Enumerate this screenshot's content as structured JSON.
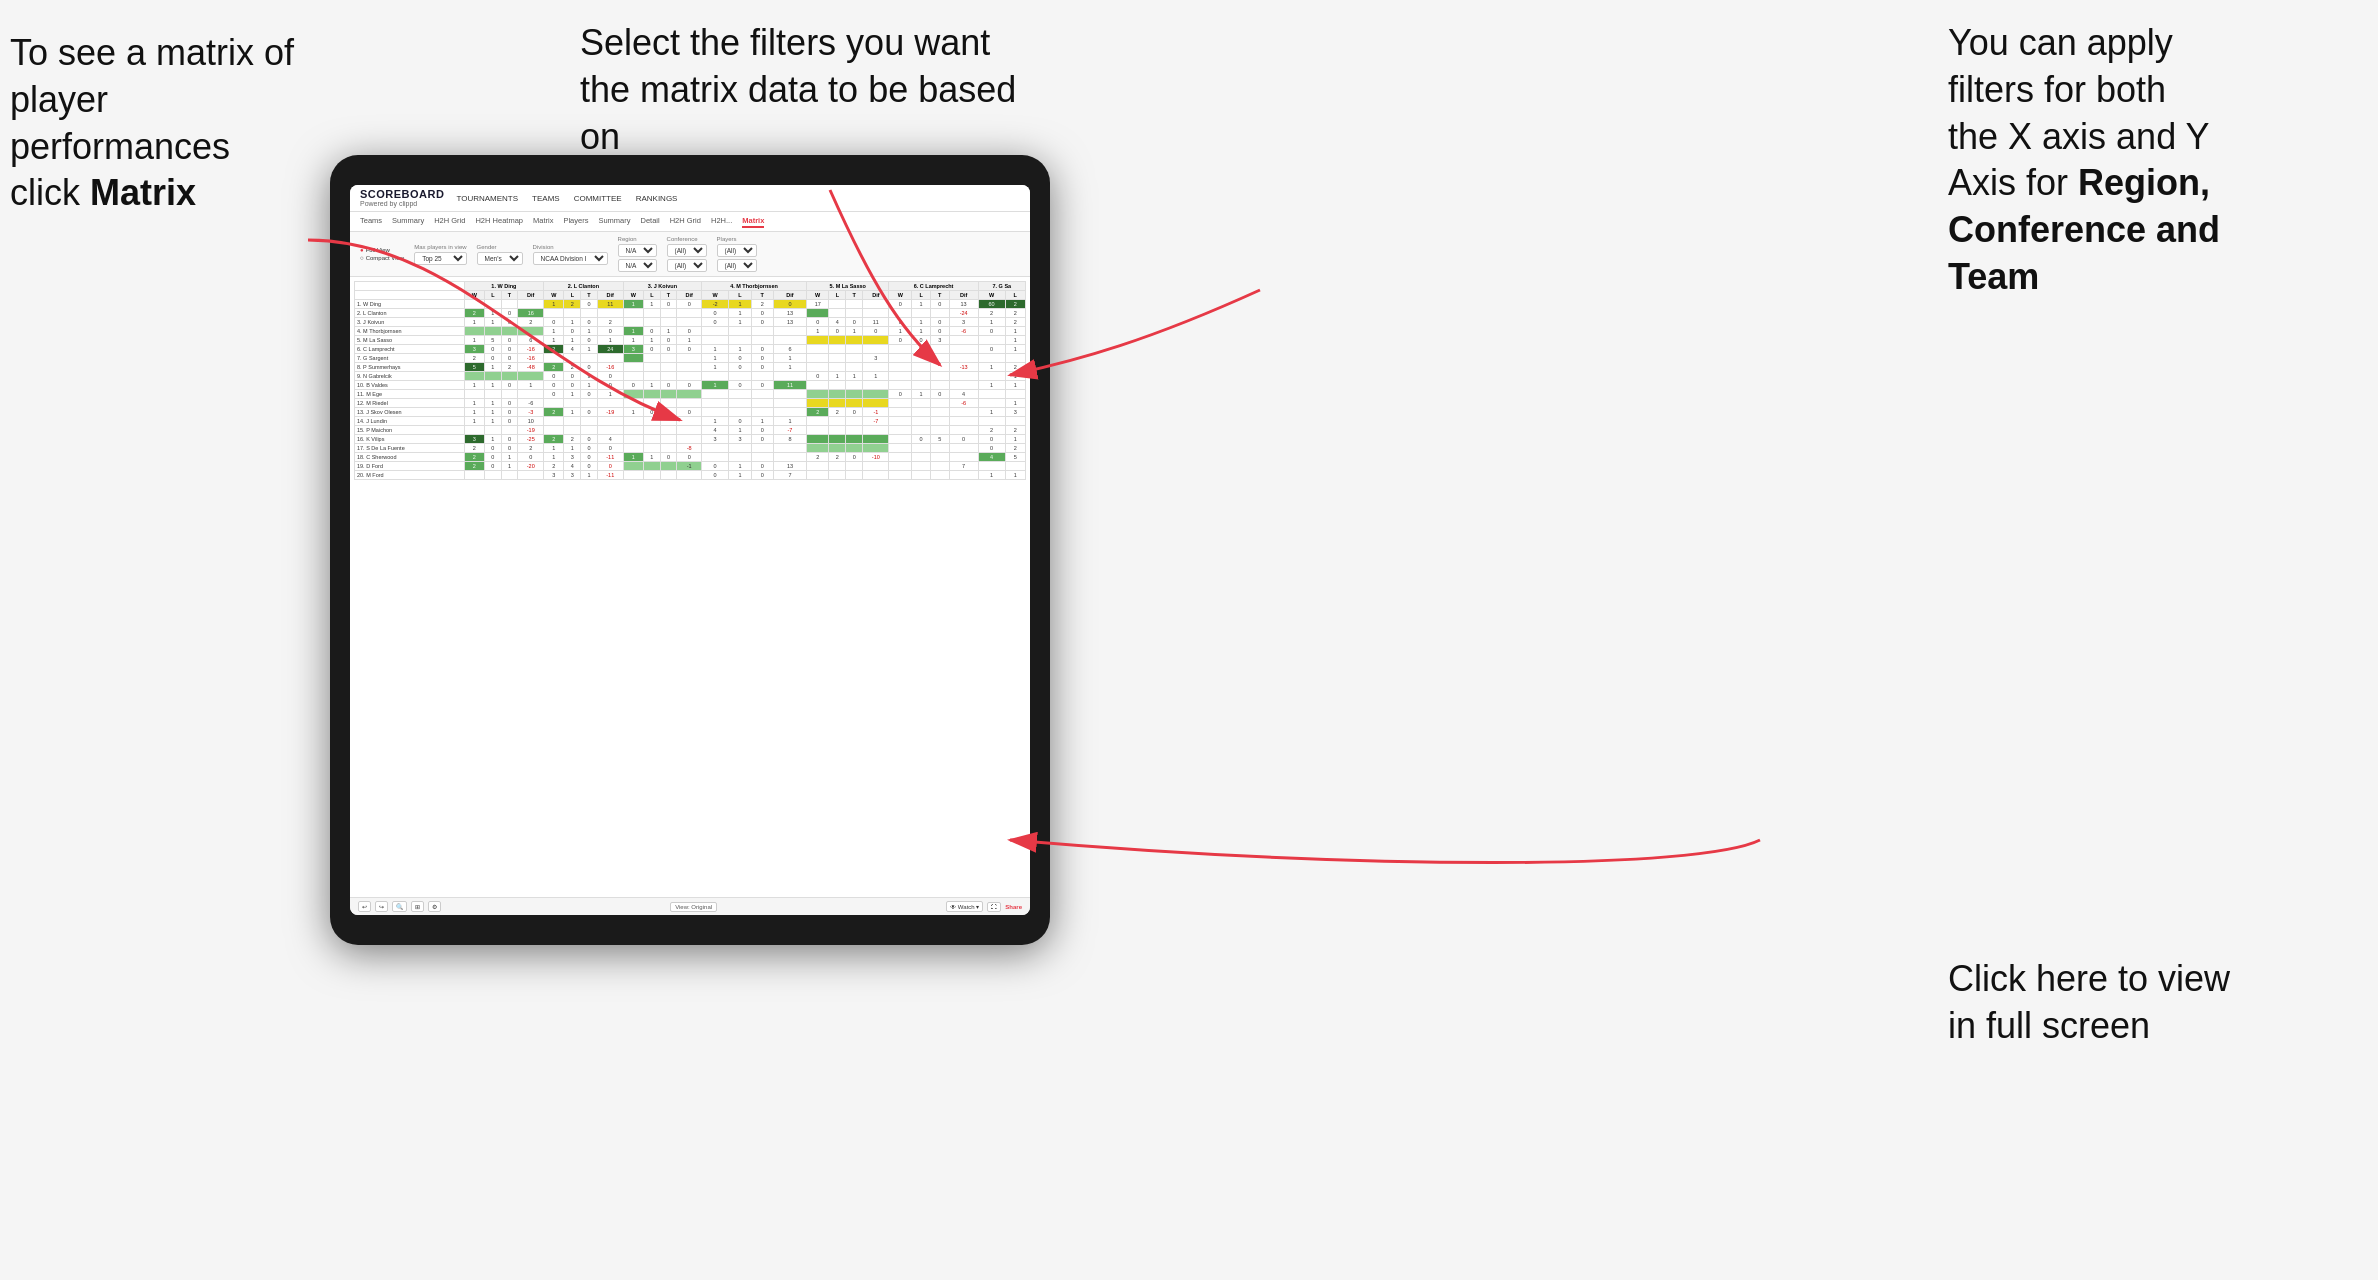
{
  "annotations": {
    "top_left": {
      "line1": "To see a matrix of",
      "line2": "player performances",
      "line3_prefix": "click ",
      "line3_bold": "Matrix"
    },
    "top_center": {
      "text": "Select the filters you want the matrix data to be based on"
    },
    "top_right": {
      "line1": "You  can apply",
      "line2": "filters for both",
      "line3": "the X axis and Y",
      "line4_prefix": "Axis for ",
      "line4_bold": "Region,",
      "line5_bold": "Conference and",
      "line6_bold": "Team"
    },
    "bottom_right": {
      "line1": "Click here to view",
      "line2": "in full screen"
    }
  },
  "app": {
    "logo_main": "SCOREBOARD",
    "logo_sub": "Powered by clippd",
    "nav": [
      "TOURNAMENTS",
      "TEAMS",
      "COMMITTEE",
      "RANKINGS"
    ],
    "sub_nav": [
      "Teams",
      "Summary",
      "H2H Grid",
      "H2H Heatmap",
      "Matrix",
      "Players",
      "Summary",
      "Detail",
      "H2H Grid",
      "H2H...",
      "Matrix"
    ],
    "active_tab": "Matrix"
  },
  "filters": {
    "view_options": [
      "Full View",
      "Compact View"
    ],
    "active_view": "Full View",
    "max_players_label": "Max players in view",
    "max_players_value": "Top 25",
    "gender_label": "Gender",
    "gender_value": "Men's",
    "division_label": "Division",
    "division_value": "NCAA Division I",
    "region_label": "Region",
    "region_value": "N/A",
    "conference_label": "Conference",
    "conference_value": "(All)",
    "players_label": "Players",
    "players_value": "(All)"
  },
  "matrix": {
    "column_headers": [
      "1. W Ding",
      "2. L Clanton",
      "3. J Koivun",
      "4. M Thorbjornsen",
      "5. M La Sasso",
      "6. C Lamprecht",
      "7. G Sa"
    ],
    "sub_headers": [
      "W",
      "L",
      "T",
      "Dif"
    ],
    "rows": [
      {
        "name": "1. W Ding",
        "data": "green_pattern"
      },
      {
        "name": "2. L Clanton",
        "data": "mixed_pattern"
      },
      {
        "name": "3. J Koivun",
        "data": "mixed_pattern"
      },
      {
        "name": "4. M Thorbjornsen",
        "data": "mixed_pattern"
      },
      {
        "name": "5. M La Sasso",
        "data": "mixed_pattern"
      },
      {
        "name": "6. C Lamprecht",
        "data": "mixed_pattern"
      },
      {
        "name": "7. G Sargent",
        "data": "mixed_pattern"
      },
      {
        "name": "8. P Summerhays",
        "data": "mixed_pattern"
      },
      {
        "name": "9. N Gabrelcik",
        "data": "mixed_pattern"
      },
      {
        "name": "10. B Valdes",
        "data": "mixed_pattern"
      },
      {
        "name": "11. M Ege",
        "data": "mixed_pattern"
      },
      {
        "name": "12. M Riedel",
        "data": "mixed_pattern"
      },
      {
        "name": "13. J Skov Olesen",
        "data": "mixed_pattern"
      },
      {
        "name": "14. J Lundin",
        "data": "mixed_pattern"
      },
      {
        "name": "15. P Maichon",
        "data": "mixed_pattern"
      },
      {
        "name": "16. K Vilips",
        "data": "mixed_pattern"
      },
      {
        "name": "17. S De La Fuente",
        "data": "mixed_pattern"
      },
      {
        "name": "18. C Sherwood",
        "data": "mixed_pattern"
      },
      {
        "name": "19. D Ford",
        "data": "mixed_pattern"
      },
      {
        "name": "20. M Ford",
        "data": "mixed_pattern"
      }
    ]
  },
  "toolbar": {
    "view_label": "View: Original",
    "watch_label": "Watch",
    "share_label": "Share",
    "undo": "↩",
    "redo": "↪"
  }
}
